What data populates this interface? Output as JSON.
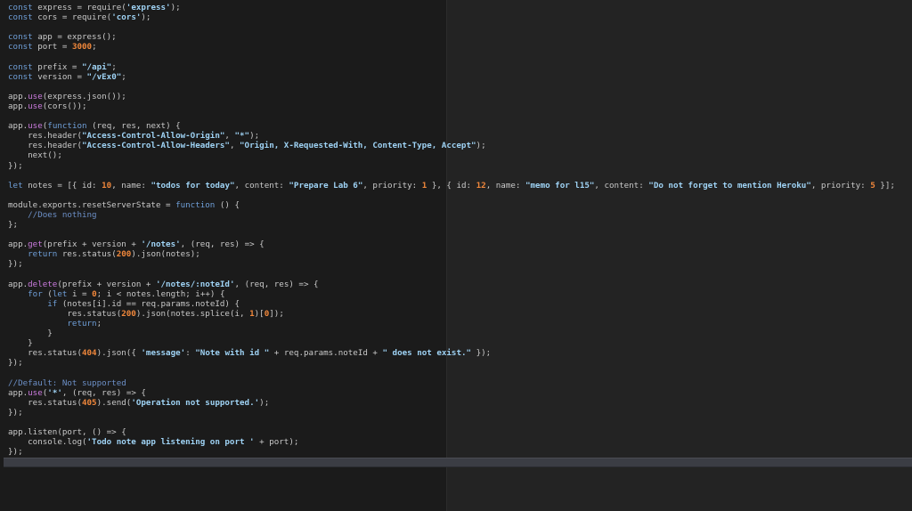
{
  "editor": {
    "language": "javascript",
    "colors": {
      "background": "#1b1b1b",
      "right_pane_background": "#232323",
      "text": "#c9c9c9",
      "keyword": "#6f9fd8",
      "string": "#9fd3f5",
      "number": "#f0873b",
      "method": "#c97adc",
      "comment": "#6c8fc6",
      "scrollbar": "#3b3d44"
    },
    "lines": [
      "const express = require('express');",
      "const cors = require('cors');",
      "",
      "const app = express();",
      "const port = 3000;",
      "",
      "const prefix = \"/api\";",
      "const version = \"/vEx0\";",
      "",
      "app.use(express.json());",
      "app.use(cors());",
      "",
      "app.use(function (req, res, next) {",
      "    res.header(\"Access-Control-Allow-Origin\", \"*\");",
      "    res.header(\"Access-Control-Allow-Headers\", \"Origin, X-Requested-With, Content-Type, Accept\");",
      "    next();",
      "});",
      "",
      "let notes = [{ id: 10, name: \"todos for today\", content: \"Prepare Lab 6\", priority: 1 }, { id: 12, name: \"memo for l15\", content: \"Do not forget to mention Heroku\", priority: 5 }];",
      "",
      "module.exports.resetServerState = function () {",
      "    //Does nothing",
      "};",
      "",
      "app.get(prefix + version + '/notes', (req, res) => {",
      "    return res.status(200).json(notes);",
      "});",
      "",
      "app.delete(prefix + version + '/notes/:noteId', (req, res) => {",
      "    for (let i = 0; i < notes.length; i++) {",
      "        if (notes[i].id == req.params.noteId) {",
      "            res.status(200).json(notes.splice(i, 1)[0]);",
      "            return;",
      "        }",
      "    }",
      "    res.status(404).json({ 'message': \"Note with id \" + req.params.noteId + \" does not exist.\" });",
      "});",
      "",
      "//Default: Not supported",
      "app.use('*', (req, res) => {",
      "    res.status(405).send('Operation not supported.');",
      "});",
      "",
      "app.listen(port, () => {",
      "    console.log('Todo note app listening on port ' + port);",
      "});"
    ]
  }
}
